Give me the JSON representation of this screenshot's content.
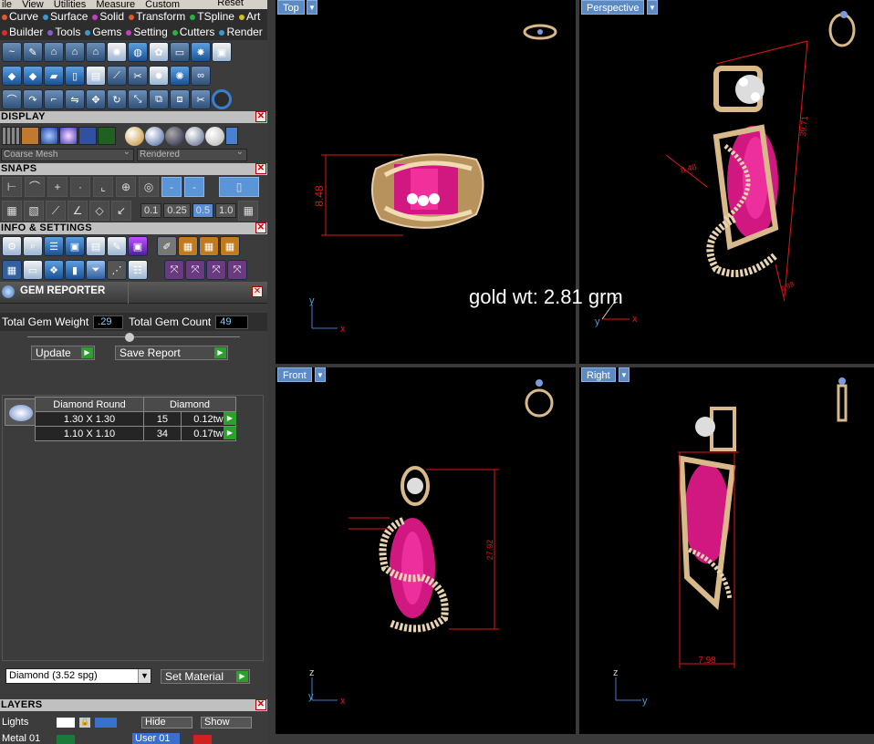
{
  "menu": [
    "ile",
    "View",
    "Utilities",
    "Measure",
    "Custom"
  ],
  "menu_reset": "Reset",
  "tabs_row1": [
    {
      "label": "Curve",
      "color": "#e05a2a"
    },
    {
      "label": "Surface",
      "color": "#3a9ad0"
    },
    {
      "label": "Solid",
      "color": "#c040c0"
    },
    {
      "label": "Transform",
      "color": "#e05a2a"
    },
    {
      "label": "TSpline",
      "color": "#2ab040"
    },
    {
      "label": "Art",
      "color": "#d0c020"
    }
  ],
  "tabs_row2": [
    {
      "label": "Builder",
      "color": "#e02a2a"
    },
    {
      "label": "Tools",
      "color": "#8a5ad0"
    },
    {
      "label": "Gems",
      "color": "#3a9ad0"
    },
    {
      "label": "Setting",
      "color": "#c040c0"
    },
    {
      "label": "Cutters",
      "color": "#2ab040"
    },
    {
      "label": "Render",
      "color": "#3a9ad0"
    }
  ],
  "display": {
    "title": "DISPLAY",
    "mesh_select": "Coarse Mesh",
    "render_select": "Rendered"
  },
  "snaps": {
    "title": "SNAPS",
    "values": [
      "0.1",
      "0.25",
      "0.5",
      "1.0"
    ]
  },
  "info": {
    "title": "INFO & SETTINGS"
  },
  "gem_reporter": {
    "title": "GEM REPORTER",
    "total_weight_label": "Total Gem Weight",
    "total_weight_value": ".29",
    "total_count_label": "Total Gem Count",
    "total_count_value": "49",
    "update_label": "Update",
    "save_label": "Save Report",
    "columns": [
      "Diamond Round",
      "Diamond"
    ],
    "rows": [
      {
        "size": "1.30 X 1.30",
        "count": "15",
        "tw": "0.12tw"
      },
      {
        "size": "1.10 X 1.10",
        "count": "34",
        "tw": "0.17tw"
      }
    ],
    "material_select": "Diamond    (3.52 spg)",
    "set_material_label": "Set Material"
  },
  "layers": {
    "title": "LAYERS",
    "row1_name": "Lights",
    "hide_label": "Hide",
    "show_label": "Show",
    "row2_name": "Metal 01",
    "row2_user": "User 01"
  },
  "viewports": {
    "top": {
      "label": "Top",
      "dimension": "8.48"
    },
    "perspective": {
      "label": "Perspective",
      "dims": [
        "39.71",
        "8.48",
        "7.98"
      ]
    },
    "front": {
      "label": "Front",
      "dimension": "27.92"
    },
    "right": {
      "label": "Right",
      "dimension": "7.98"
    }
  },
  "overlay_text": "gold wt: 2.81 grm",
  "axes": {
    "x": "x",
    "y": "y",
    "z": "z"
  },
  "colors": {
    "gold": "#d9b98a",
    "gem": "#e0108a",
    "dim": "#e01818",
    "viewport_label": "#5c8ac4"
  }
}
